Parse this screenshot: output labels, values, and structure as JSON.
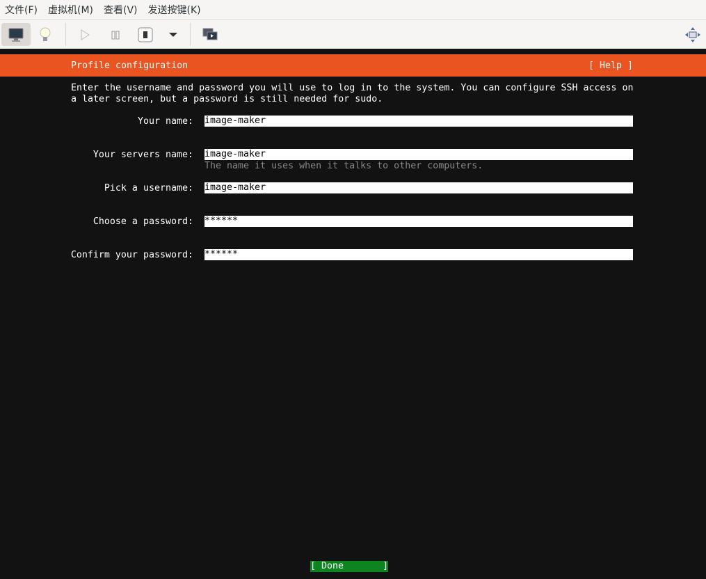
{
  "menu": [
    "文件(F)",
    "虚拟机(M)",
    "查看(V)",
    "发送按键(K)"
  ],
  "toolbar": {
    "icons": [
      "console-icon",
      "details-bulb-icon",
      "run-icon",
      "pause-icon",
      "shutdown-icon",
      "shutdown-menu-icon",
      "snapshots-icon",
      "fullscreen-icon"
    ]
  },
  "screen": {
    "title": "Profile configuration",
    "help": "[ Help ]",
    "intro": [
      "Enter the username and password you will use to log in to the system. You can configure SSH access on",
      "a later screen, but a password is still needed for sudo."
    ],
    "fields": [
      {
        "label": "Your name:",
        "value": "image-maker"
      },
      {
        "label": "Your servers name:",
        "value": "image-maker",
        "hint": "The name it uses when it talks to other computers."
      },
      {
        "label": "Pick a username:",
        "value": "image-maker"
      },
      {
        "label": "Choose a password:",
        "value": "******"
      },
      {
        "label": "Confirm your password:",
        "value": "******"
      }
    ],
    "done": "[ Done       ]"
  },
  "colors": {
    "accent": "#e95420",
    "done": "#0e8420"
  }
}
